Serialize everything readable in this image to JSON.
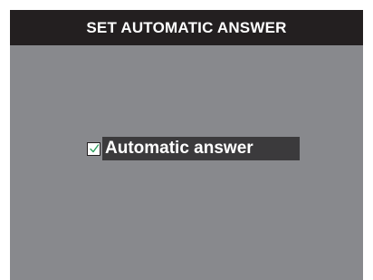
{
  "header": {
    "title": "SET AUTOMATIC ANSWER"
  },
  "option": {
    "label": "Automatic answer",
    "checked": true,
    "icon": "checkmark-icon"
  },
  "colors": {
    "title_bar": "#231f20",
    "screen_background": "#88898d",
    "selected_highlight": "#3b3a3c",
    "checkmark": "#2a9d5c"
  }
}
